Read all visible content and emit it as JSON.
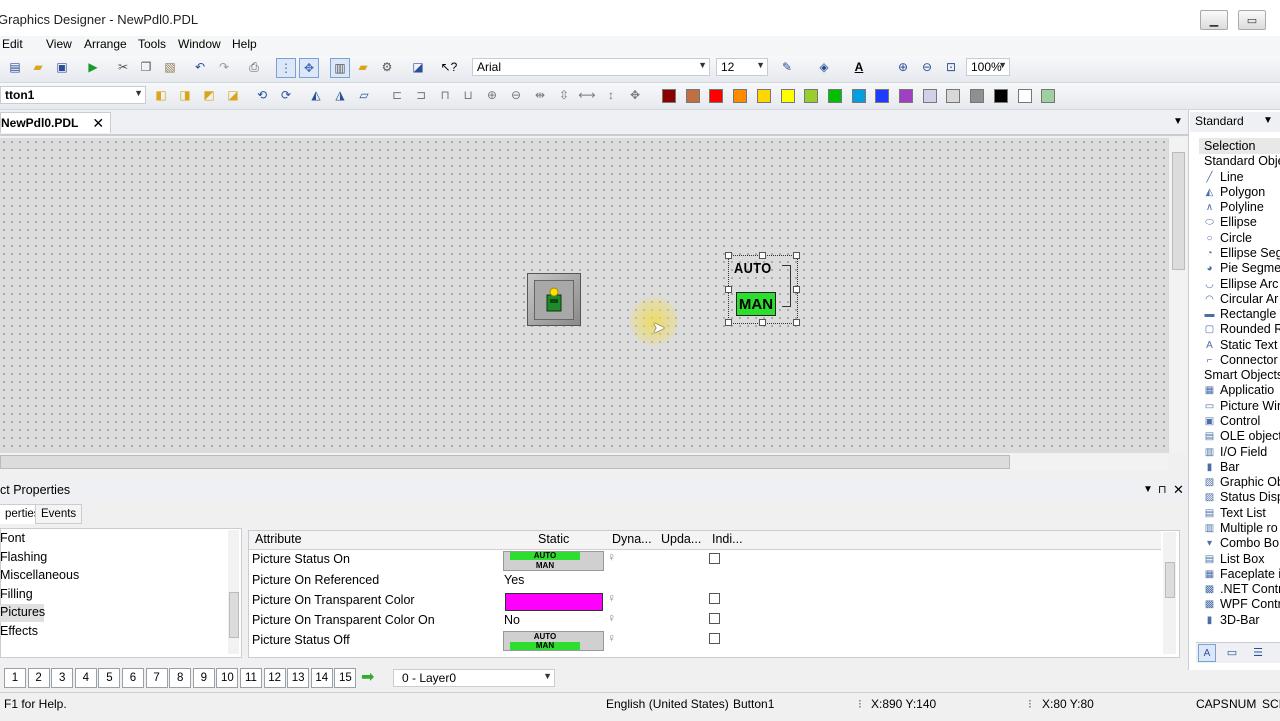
{
  "window": {
    "title": "Graphics Designer - NewPdl0.PDL"
  },
  "menu": [
    "Edit",
    "View",
    "Arrange",
    "Tools",
    "Window",
    "Help"
  ],
  "toolbar": {
    "font": "Arial",
    "font_size": "12",
    "zoom": "100%"
  },
  "object_selector": {
    "value": "tton1"
  },
  "colors": [
    "#8b0000",
    "#c07040",
    "#ff0000",
    "#ff8c00",
    "#ffd700",
    "#ffff00",
    "#9acd32",
    "#00c000",
    "#00a0e0",
    "#1e3cff",
    "#a040c0",
    "#d0d0e8",
    "#d8d8d8",
    "#909090",
    "#000000",
    "#ffffff",
    "#a0d0a0"
  ],
  "document": {
    "tab": "NewPdl0.PDL"
  },
  "canvas": {
    "button_auto": "AUTO",
    "button_man": "MAN"
  },
  "properties": {
    "title": "ct Properties",
    "tabs": [
      "perties",
      "Events"
    ],
    "tree": [
      "Font",
      "Flashing",
      "Miscellaneous",
      "Filling",
      "Pictures",
      "Effects"
    ],
    "selected_tree_item": "Pictures",
    "columns": [
      "Attribute",
      "Static",
      "Dyna...",
      "Upda...",
      "Indi..."
    ],
    "rows": [
      {
        "attr": "Picture Status On",
        "static": ""
      },
      {
        "attr": "Picture On Referenced",
        "static": "Yes"
      },
      {
        "attr": "Picture On Transparent Color",
        "static": ""
      },
      {
        "attr": "Picture On Transparent Color On",
        "static": "No"
      },
      {
        "attr": "Picture Status Off",
        "static": ""
      }
    ],
    "transparent_color": "#ff00ff"
  },
  "layers": {
    "numbers": [
      "1",
      "2",
      "3",
      "4",
      "5",
      "6",
      "7",
      "8",
      "9",
      "10",
      "11",
      "12",
      "13",
      "14",
      "15"
    ],
    "current": "0 - Layer0"
  },
  "status": {
    "help": "F1 for Help.",
    "language": "English (United States)",
    "object": "Button1",
    "position": "X:890 Y:140",
    "size": "X:80 Y:80",
    "caps": "CAPS",
    "num": "NUM",
    "scrl": "SCI"
  },
  "right_panel": {
    "dropdown": "Standard",
    "items": [
      "Selection",
      "Standard Obje",
      "Line",
      "Polygon",
      "Polyline",
      "Ellipse",
      "Circle",
      "Ellipse Seg",
      "Pie Segme",
      "Ellipse Arc",
      "Circular Ar",
      "Rectangle",
      "Rounded R",
      "Static Text",
      "Connector",
      "Smart Objects",
      "Applicatio",
      "Picture Win",
      "Control",
      "OLE object",
      "I/O Field",
      "Bar",
      "Graphic Ob",
      "Status Disp",
      "Text List",
      "Multiple ro",
      "Combo Bo",
      "List Box",
      "Faceplate i",
      ".NET Contr",
      "WPF Contr",
      "3D-Bar"
    ]
  }
}
